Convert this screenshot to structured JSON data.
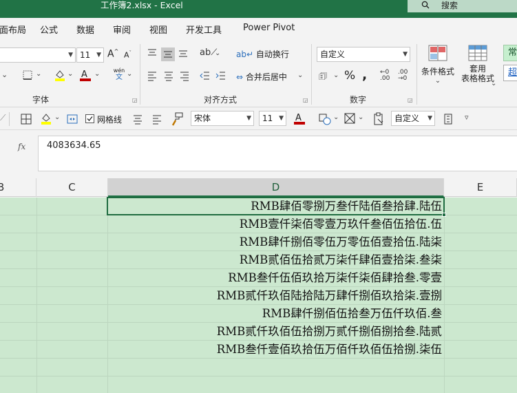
{
  "window": {
    "title": "工作簿2.xlsx  -  Excel",
    "search_label": "搜索"
  },
  "menu": [
    "页面布局",
    "公式",
    "数据",
    "审阅",
    "视图",
    "开发工具",
    "Power Pivot"
  ],
  "ribbon": {
    "font_size": "11",
    "font_group_label": "字体",
    "align_group_label": "对齐方式",
    "wrap_text": "自动换行",
    "merge_center": "合并后居中",
    "number_format": "自定义",
    "number_group_label": "数字",
    "cond_format_label": "条件格式",
    "table_format_label_1": "套用",
    "table_format_label_2": "表格格式",
    "style_normal": "常",
    "style_hyper": "超",
    "phonetic_label": "wén",
    "phonetic_sub": "文"
  },
  "mini_toolbar": {
    "gridlines_label": "网格线",
    "font_name": "宋体",
    "font_size": "11",
    "number_format": "自定义"
  },
  "formula_bar": {
    "value": "4083634.65"
  },
  "columns": [
    "B",
    "C",
    "D",
    "E"
  ],
  "cells": [
    "RMB肆佰零捌万叁仟陆佰叁拾肆.陆伍",
    "RMB壹仟柒佰零壹万玖仟叁佰伍拾伍.伍",
    "RMB肆仟捌佰零伍万零伍佰壹拾伍.陆柒",
    "RMB贰佰伍拾贰万柒仟肆佰壹拾柒.叁柒",
    "RMB叁仟伍佰玖拾万柒仟柒佰肆拾叁.零壹",
    "RMB贰仟玖佰陆拾陆万肆仟捌佰玖拾柒.壹捌",
    "RMB肆仟捌佰伍拾叁万伍仟玖佰.叁",
    "RMB贰仟玖佰伍拾捌万贰仟捌佰捌拾叁.陆贰",
    "RMB叁仟壹佰玖拾伍万佰仟玖佰伍拾捌.柒伍"
  ],
  "colors": {
    "brand": "#217346",
    "grid_fill": "#cce8cf",
    "font_red": "#c00000",
    "fill_yellow": "#ffff00"
  }
}
